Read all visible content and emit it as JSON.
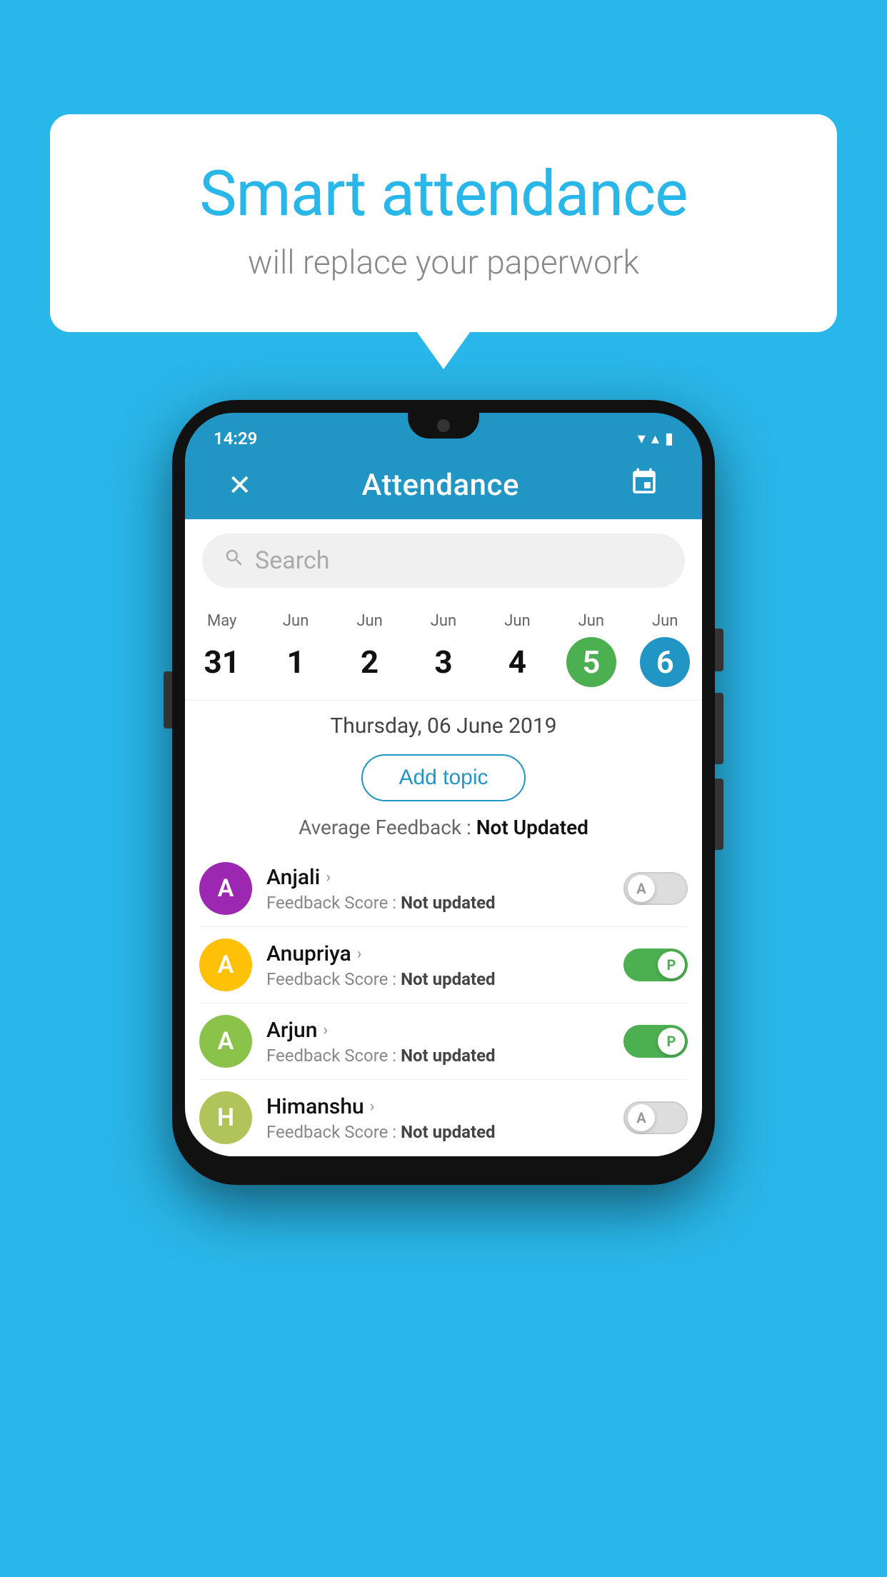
{
  "background": {
    "color": "#29b6e8"
  },
  "speech_bubble": {
    "title": "Smart attendance",
    "subtitle": "will replace your paperwork"
  },
  "status_bar": {
    "time": "14:29",
    "wifi_icon": "▼",
    "signal_icon": "▲",
    "battery_icon": "▮"
  },
  "app_header": {
    "close_label": "✕",
    "title": "Attendance",
    "calendar_icon": "📅"
  },
  "search": {
    "placeholder": "Search"
  },
  "calendar": {
    "days": [
      {
        "month": "May",
        "number": "31",
        "state": "normal"
      },
      {
        "month": "Jun",
        "number": "1",
        "state": "normal"
      },
      {
        "month": "Jun",
        "number": "2",
        "state": "normal"
      },
      {
        "month": "Jun",
        "number": "3",
        "state": "normal"
      },
      {
        "month": "Jun",
        "number": "4",
        "state": "normal"
      },
      {
        "month": "Jun",
        "number": "5",
        "state": "today"
      },
      {
        "month": "Jun",
        "number": "6",
        "state": "selected"
      }
    ]
  },
  "date_header": "Thursday, 06 June 2019",
  "add_topic_label": "Add topic",
  "avg_feedback_label": "Average Feedback :",
  "avg_feedback_value": "Not Updated",
  "students": [
    {
      "name": "Anjali",
      "avatar_letter": "A",
      "avatar_color": "#9c27b0",
      "feedback_label": "Feedback Score :",
      "feedback_value": "Not updated",
      "toggle_state": "off",
      "toggle_label": "A"
    },
    {
      "name": "Anupriya",
      "avatar_letter": "A",
      "avatar_color": "#ffc107",
      "feedback_label": "Feedback Score :",
      "feedback_value": "Not updated",
      "toggle_state": "on",
      "toggle_label": "P"
    },
    {
      "name": "Arjun",
      "avatar_letter": "A",
      "avatar_color": "#8bc34a",
      "feedback_label": "Feedback Score :",
      "feedback_value": "Not updated",
      "toggle_state": "on",
      "toggle_label": "P"
    },
    {
      "name": "Himanshu",
      "avatar_letter": "H",
      "avatar_color": "#b0c45a",
      "feedback_label": "Feedback Score :",
      "feedback_value": "Not updated",
      "toggle_state": "off",
      "toggle_label": "A"
    }
  ]
}
